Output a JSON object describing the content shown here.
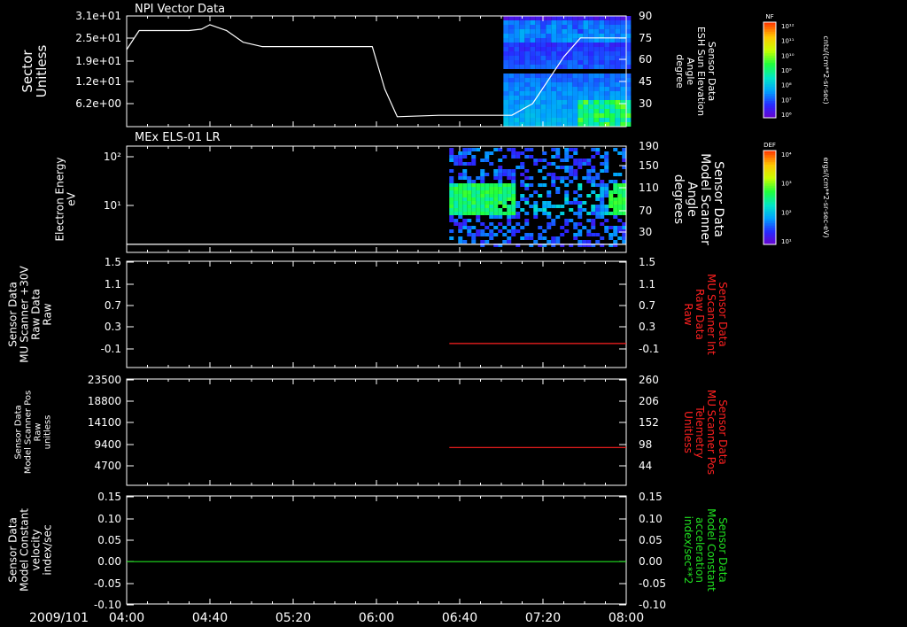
{
  "date_label": "2009/101",
  "x_ticks": [
    "04:00",
    "04:40",
    "05:20",
    "06:00",
    "06:40",
    "07:20",
    "08:00"
  ],
  "colorbars": [
    {
      "tag": "NF",
      "tick_labels": [
        "10¹²",
        "10¹¹",
        "10¹⁰",
        "10⁹",
        "10⁸",
        "10⁷",
        "10⁶"
      ],
      "unit": "cnts/(cm**2-sr-sec)"
    },
    {
      "tag": "DEF",
      "tick_labels": [
        "10⁴",
        "10³",
        "10²",
        "10¹"
      ],
      "unit": "ergs/(cm**2-sr-sec-eV)"
    }
  ],
  "chart_data": [
    {
      "type": "line",
      "title": "NPI Vector Data",
      "ylabel": [
        "Sector",
        "Unitless"
      ],
      "yticks": [
        "3.1e+01",
        "2.5e+01",
        "1.9e+01",
        "1.2e+01",
        "6.2e+00"
      ],
      "right_ylabel": [
        "Sensor Data",
        "ESH Sun Elevation",
        "Angle",
        "degree"
      ],
      "right_yticks": [
        "90",
        "75",
        "60",
        "45",
        "30"
      ],
      "right_ylim": [
        20,
        90
      ],
      "line_color": "#ffffff",
      "series": [
        {
          "x": [
            "04:00",
            "04:06",
            "04:30",
            "04:36",
            "04:40",
            "04:48",
            "04:56",
            "05:05",
            "05:40",
            "05:58",
            "06:04",
            "06:10",
            "06:30",
            "07:00",
            "07:05",
            "07:15",
            "07:30",
            "07:38",
            "08:00"
          ],
          "y": [
            67,
            80,
            80,
            81,
            84,
            80,
            72,
            69,
            69,
            69,
            40,
            21,
            22,
            22,
            22,
            30,
            62,
            75,
            75
          ]
        }
      ],
      "spectrogram": {
        "x_start": "07:01",
        "x_end": "08:00",
        "colorbar": "NF"
      }
    },
    {
      "type": "heatmap",
      "title": "MEx ELS-01 LR",
      "ylabel": [
        "Electron Energy",
        "eV"
      ],
      "yticks": [
        "10²",
        "10¹"
      ],
      "right_ylabel": [
        "Sensor Data",
        "Model Scanner",
        "Angle",
        "degrees"
      ],
      "right_yticks": [
        "190",
        "150",
        "110",
        "70",
        "30"
      ],
      "right_ylim": [
        0,
        190
      ],
      "line_color": "#ffffff",
      "series": [
        {
          "x": [
            "04:00",
            "08:00"
          ],
          "y": [
            7,
            7
          ]
        }
      ],
      "spectrogram": {
        "x_start": "06:35",
        "x_end": "08:00",
        "colorbar": "DEF"
      }
    },
    {
      "type": "line",
      "ylabel": [
        "Sensor Data",
        "MU Scanner +30V",
        "Raw Data",
        "Raw"
      ],
      "yticks": [
        "1.5",
        "1.1",
        "0.7",
        "0.3",
        "-0.1"
      ],
      "ylim": [
        -0.3,
        1.5
      ],
      "right_ylabel": [
        "Sensor Data",
        "MU Scanner Int",
        "Raw Data",
        "Raw"
      ],
      "right_yticks": [
        "1.5",
        "1.1",
        "0.7",
        "0.3",
        "-0.1"
      ],
      "right_label_color": "#ff2020",
      "line_color": "#ff2020",
      "series": [
        {
          "x": [
            "06:35",
            "08:00"
          ],
          "y": [
            0.0,
            0.0
          ]
        }
      ]
    },
    {
      "type": "line",
      "ylabel": [
        "Sensor Data",
        "Model Scanner Pos",
        "Raw",
        "unitless"
      ],
      "yticks": [
        "23500",
        "18800",
        "14100",
        "9400",
        "4700"
      ],
      "right_ylabel": [
        "Sensor Data",
        "MU Scanner Pos",
        "Telemetry",
        "Unitless"
      ],
      "right_yticks": [
        "260",
        "206",
        "152",
        "98",
        "44"
      ],
      "right_ylim": [
        0,
        260
      ],
      "right_label_color": "#ff2020",
      "line_color": "#ff2020",
      "series": [
        {
          "x": [
            "06:35",
            "08:00"
          ],
          "y": [
            90,
            90
          ]
        }
      ]
    },
    {
      "type": "line",
      "ylabel": [
        "Sensor Data",
        "Model Constant",
        "velocity",
        "index/sec"
      ],
      "yticks": [
        "0.15",
        "0.10",
        "0.05",
        "0.00",
        "-0.05",
        "-0.10"
      ],
      "ylim": [
        -0.1,
        0.15
      ],
      "right_ylabel": [
        "Sensor Data",
        "Model Constant",
        "acceleration",
        "index/sec**2"
      ],
      "right_yticks": [
        "0.15",
        "0.10",
        "0.05",
        "0.00",
        "-0.05",
        "-0.10"
      ],
      "right_label_color": "#20e020",
      "line_color": "#20e020",
      "series": [
        {
          "x": [
            "04:00",
            "08:00"
          ],
          "y": [
            0.0,
            0.0
          ]
        }
      ]
    }
  ]
}
